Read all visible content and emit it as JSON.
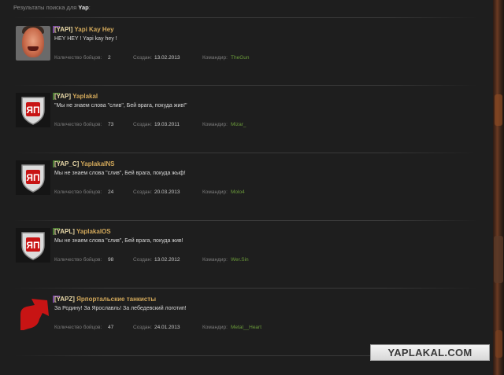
{
  "header": {
    "prefix": "Результаты поиска для",
    "query": "Yap"
  },
  "labels": {
    "members": "Количество бойцов:",
    "created": "Создан:",
    "commander": "Командир:"
  },
  "clans": [
    {
      "tag": "[YAPI]",
      "name": "Yapi Kay Hey",
      "motto": "HEY HEY ! Yapi kay hey !",
      "members": "2",
      "created": "13.02.2013",
      "commander": "TheGun",
      "emblem": "avatar-face"
    },
    {
      "tag": "[YAP]",
      "name": "Yaplakal",
      "motto": "\"Мы не знаем слова \"слив\", Бей врага, покуда жив!\"",
      "members": "73",
      "created": "19.03.2011",
      "commander": "Mizar_",
      "emblem": "yap-shield"
    },
    {
      "tag": "[YAP_C]",
      "name": "YaplakalNS",
      "motto": "Мы не знаем слова \"слив\", Бей врага, покуда жыф!",
      "members": "24",
      "created": "20.03.2013",
      "commander": "Molo4",
      "emblem": "yap-shield"
    },
    {
      "tag": "[YAPL]",
      "name": "YaplakalOS",
      "motto": "Мы не знаем слова \"слив\", Бей врага, покуда жив!",
      "members": "98",
      "created": "13.02.2012",
      "commander": "Wer.Sin",
      "emblem": "yap-shield"
    },
    {
      "tag": "[YAPZ]",
      "name": "Ярпортальские танкисты",
      "motto": "За Родину! За Ярославль! За лебедевский логотип!",
      "members": "47",
      "created": "24.01.2013",
      "commander": "Metal__Heart",
      "emblem": "red-arrow"
    }
  ],
  "watermark": "YAPLAKAL.COM",
  "colors": {
    "background": "#1e1e1e",
    "tag": "#e8d8a8",
    "name": "#d2a85a",
    "commander": "#6a9a3a",
    "emblem_red": "#c81414"
  }
}
